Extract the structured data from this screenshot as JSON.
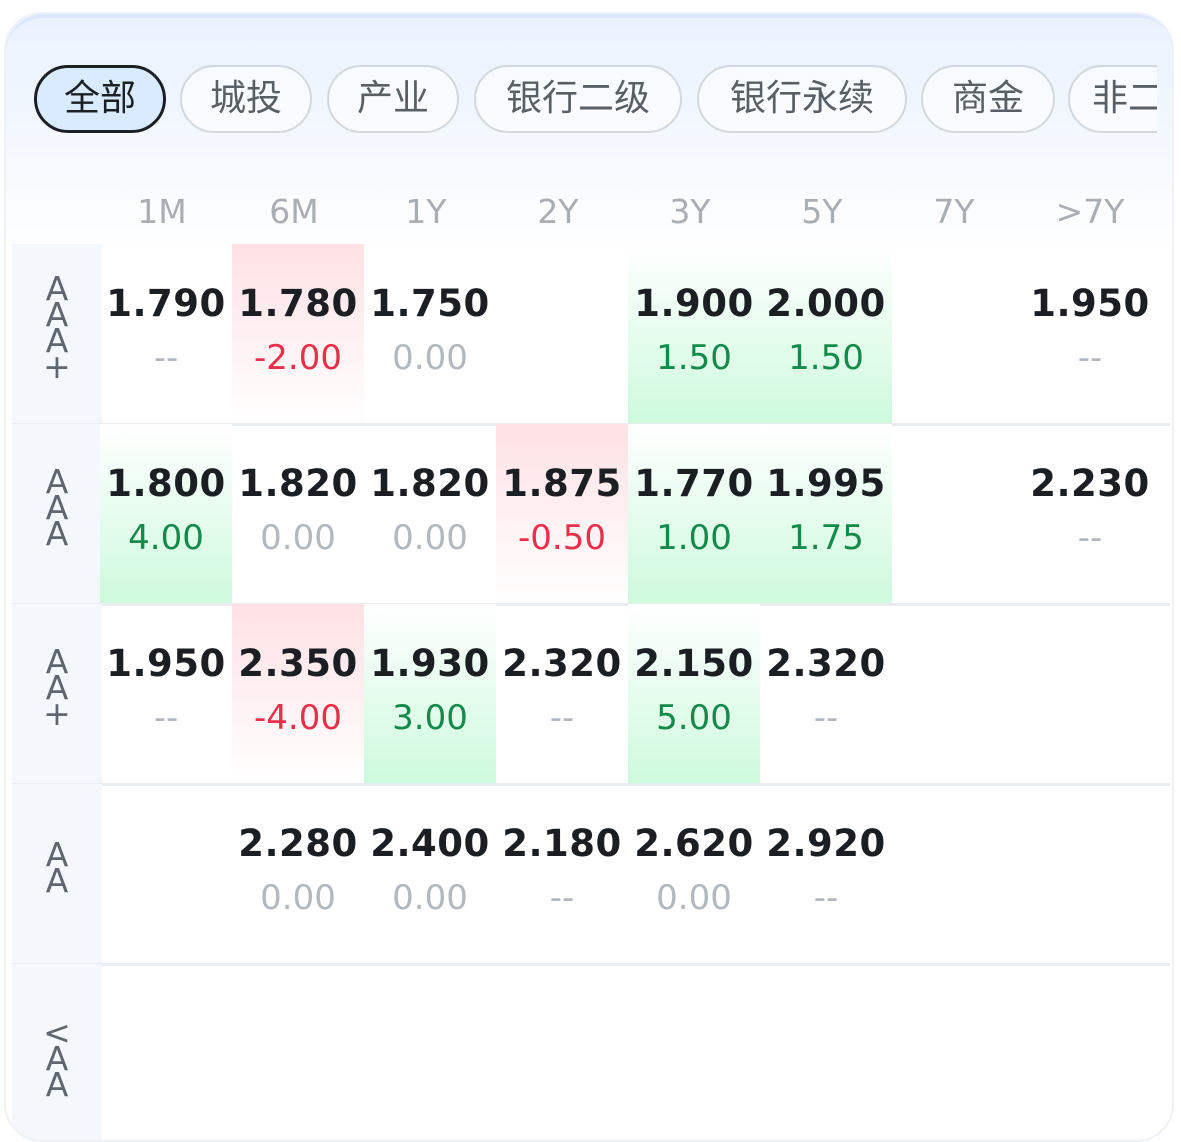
{
  "filters": {
    "chips": [
      {
        "label": "全部",
        "active": true
      },
      {
        "label": "城投",
        "active": false
      },
      {
        "label": "产业",
        "active": false
      },
      {
        "label": "银行二级",
        "active": false
      },
      {
        "label": "银行永续",
        "active": false
      },
      {
        "label": "商金",
        "active": false
      },
      {
        "label": "非二",
        "active": false
      }
    ]
  },
  "tenors": [
    "1M",
    "6M",
    "1Y",
    "2Y",
    "3Y",
    "5Y",
    "7Y",
    ">7Y"
  ],
  "ratings": [
    {
      "label": [
        "A",
        "A",
        "A",
        "+"
      ]
    },
    {
      "label": [
        "A",
        "A",
        "A"
      ]
    },
    {
      "label": [
        "A",
        "A",
        "+"
      ]
    },
    {
      "label": [
        "A",
        "A"
      ]
    },
    {
      "label": [
        "<",
        "A",
        "A"
      ]
    }
  ],
  "grid": [
    [
      {
        "value": "1.790",
        "change": "--",
        "trend": "flat"
      },
      {
        "value": "1.780",
        "change": "-2.00",
        "trend": "up"
      },
      {
        "value": "1.750",
        "change": "0.00",
        "trend": "flat"
      },
      {
        "value": "",
        "change": "",
        "trend": "none"
      },
      {
        "value": "1.900",
        "change": "1.50",
        "trend": "down"
      },
      {
        "value": "2.000",
        "change": "1.50",
        "trend": "down"
      },
      {
        "value": "",
        "change": "",
        "trend": "none"
      },
      {
        "value": "1.950",
        "change": "--",
        "trend": "flat"
      }
    ],
    [
      {
        "value": "1.800",
        "change": "4.00",
        "trend": "down"
      },
      {
        "value": "1.820",
        "change": "0.00",
        "trend": "flat"
      },
      {
        "value": "1.820",
        "change": "0.00",
        "trend": "flat"
      },
      {
        "value": "1.875",
        "change": "-0.50",
        "trend": "up"
      },
      {
        "value": "1.770",
        "change": "1.00",
        "trend": "down"
      },
      {
        "value": "1.995",
        "change": "1.75",
        "trend": "down"
      },
      {
        "value": "",
        "change": "",
        "trend": "none"
      },
      {
        "value": "2.230",
        "change": "--",
        "trend": "flat"
      }
    ],
    [
      {
        "value": "1.950",
        "change": "--",
        "trend": "flat"
      },
      {
        "value": "2.350",
        "change": "-4.00",
        "trend": "up"
      },
      {
        "value": "1.930",
        "change": "3.00",
        "trend": "down"
      },
      {
        "value": "2.320",
        "change": "--",
        "trend": "flat"
      },
      {
        "value": "2.150",
        "change": "5.00",
        "trend": "down"
      },
      {
        "value": "2.320",
        "change": "--",
        "trend": "flat"
      },
      {
        "value": "",
        "change": "",
        "trend": "none"
      },
      {
        "value": "",
        "change": "",
        "trend": "none"
      }
    ],
    [
      {
        "value": "",
        "change": "",
        "trend": "none"
      },
      {
        "value": "2.280",
        "change": "0.00",
        "trend": "flat"
      },
      {
        "value": "2.400",
        "change": "0.00",
        "trend": "flat"
      },
      {
        "value": "2.180",
        "change": "--",
        "trend": "flat"
      },
      {
        "value": "2.620",
        "change": "0.00",
        "trend": "flat"
      },
      {
        "value": "2.920",
        "change": "--",
        "trend": "flat"
      },
      {
        "value": "",
        "change": "",
        "trend": "none"
      },
      {
        "value": "",
        "change": "",
        "trend": "none"
      }
    ],
    [
      {
        "value": "",
        "change": "",
        "trend": "none"
      },
      {
        "value": "",
        "change": "",
        "trend": "none"
      },
      {
        "value": "",
        "change": "",
        "trend": "none"
      },
      {
        "value": "",
        "change": "",
        "trend": "none"
      },
      {
        "value": "",
        "change": "",
        "trend": "none"
      },
      {
        "value": "",
        "change": "",
        "trend": "none"
      },
      {
        "value": "",
        "change": "",
        "trend": "none"
      },
      {
        "value": "",
        "change": "",
        "trend": "none"
      }
    ]
  ],
  "colors": {
    "up": "#ea2f4a",
    "down": "#148a4a",
    "neutral": "#b3b8be",
    "active_chip_bg": "#d9ebff"
  }
}
